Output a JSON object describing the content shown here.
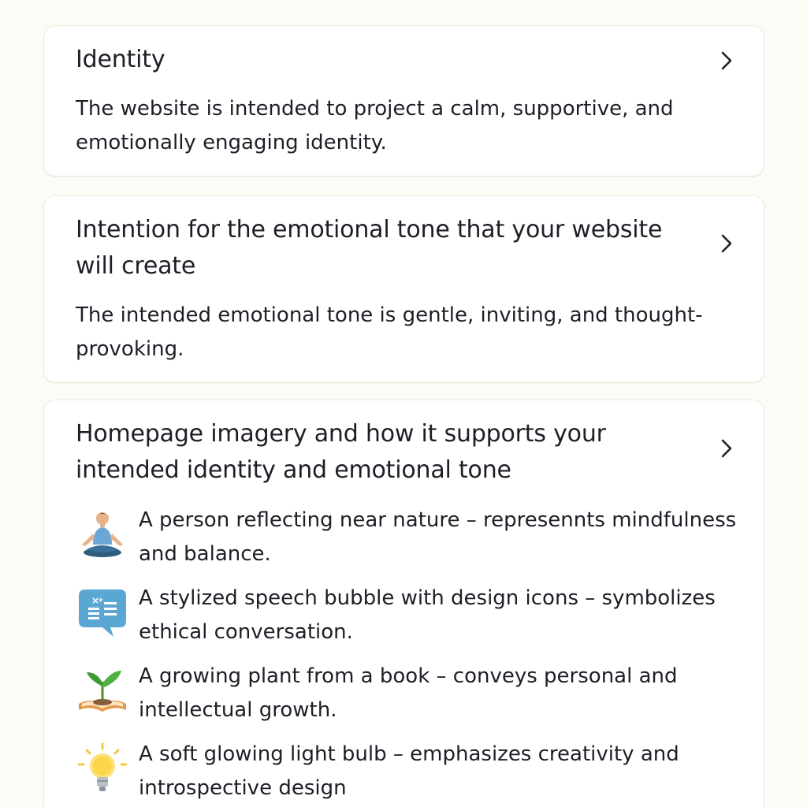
{
  "sections": [
    {
      "title": "Identity",
      "text": "The website is intended to project a calm, supportive, and emotionally engaging identity."
    },
    {
      "title": "Intention for the emotional tone that your website will create",
      "text": "The intended emotional tone is gentle, inviting, and thought-provoking."
    },
    {
      "title": "Homepage imagery and how it supports your intended identity and emotional tone",
      "items": [
        {
          "icon": "meditating-person-icon",
          "text": "A person reflecting near nature – represennts mindfulness and balance."
        },
        {
          "icon": "speech-bubble-icon",
          "text": "A stylized speech bubble with design icons – symbolizes ethical conversation."
        },
        {
          "icon": "plant-book-icon",
          "text": "A growing plant from a book – conveys personal and intellectual growth."
        },
        {
          "icon": "light-bulb-icon",
          "text": "A soft glowing light bulb – emphasizes creativity and introspective design"
        }
      ]
    }
  ],
  "colors": {
    "background": "#fdfbf5",
    "card": "#ffffff",
    "text": "#1c1f26"
  }
}
